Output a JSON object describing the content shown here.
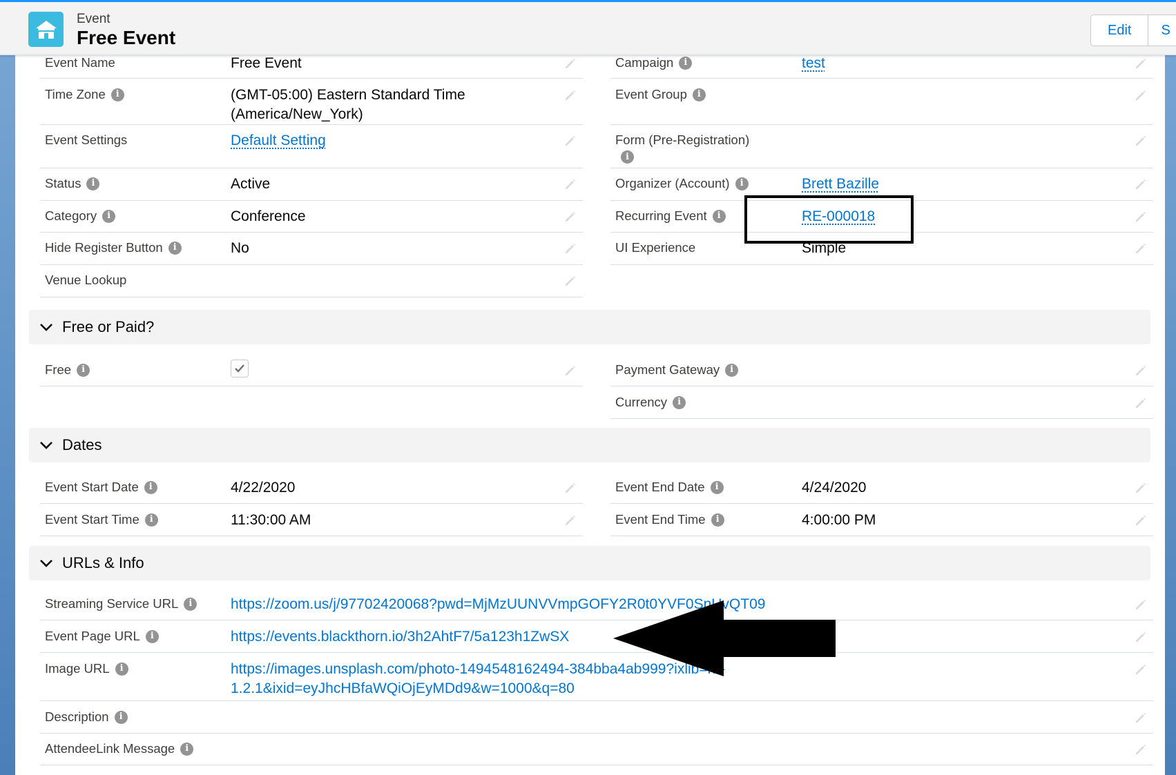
{
  "header": {
    "object_label": "Event",
    "record_title": "Free Event",
    "buttons": [
      "Edit",
      "S"
    ]
  },
  "colors": {
    "link": "#0176d3",
    "accent": "#1b96ff",
    "icon_bg": "#3cbbe0"
  },
  "info_glyph": "i",
  "fields_top": {
    "left": [
      {
        "label": "Event Name",
        "value": "Free Event",
        "info": false
      },
      {
        "label": "Time Zone",
        "value_line1": "(GMT-05:00) Eastern Standard Time",
        "value_line2": "(America/New_York)",
        "info": true
      },
      {
        "label": "Event Settings",
        "value": "Default Setting",
        "info": false
      },
      {
        "label": "Status",
        "value": "Active",
        "info": true
      },
      {
        "label": "Category",
        "value": "Conference",
        "info": true
      },
      {
        "label": "Hide Register Button",
        "value": "No",
        "info": true
      },
      {
        "label": "Venue Lookup",
        "value": "",
        "info": false
      }
    ],
    "right": [
      {
        "label": "Campaign",
        "value": "test",
        "info": true
      },
      {
        "label": "Event Group",
        "value": "",
        "info": true
      },
      {
        "label": "Form (Pre-Registration)",
        "value": "",
        "info": true
      },
      {
        "label": "Organizer (Account)",
        "value": "Brett Bazille",
        "info": true
      },
      {
        "label": "Recurring Event",
        "value": "RE-000018",
        "info": true
      },
      {
        "label": "UI Experience",
        "value": "Simple",
        "info": false
      }
    ]
  },
  "section_free": {
    "title": "Free or Paid?",
    "left": [
      {
        "label": "Free",
        "checked": true
      }
    ],
    "right": [
      {
        "label": "Payment Gateway",
        "value": ""
      },
      {
        "label": "Currency",
        "value": ""
      }
    ]
  },
  "section_dates": {
    "title": "Dates",
    "left": [
      {
        "label": "Event Start Date",
        "value": "4/22/2020"
      },
      {
        "label": "Event Start Time",
        "value": "11:30:00 AM"
      }
    ],
    "right": [
      {
        "label": "Event End Date",
        "value": "4/24/2020"
      },
      {
        "label": "Event End Time",
        "value": "4:00:00 PM"
      }
    ]
  },
  "section_urls": {
    "title": "URLs & Info",
    "rows": [
      {
        "label": "Streaming Service URL",
        "value": "https://zoom.us/j/97702420068?pwd=MjMzUUNVVmpGOFY2R0t0YVF0SnUvQT09"
      },
      {
        "label": "Event Page URL",
        "value": "https://events.blackthorn.io/3h2AhtF7/5a123h1ZwSX"
      },
      {
        "label": "Image URL",
        "value_line1": "https://images.unsplash.com/photo-1494548162494-384bba4ab999?ixlib=rb-",
        "value_line2": "1.2.1&ixid=eyJhcHBfaWQiOjEyMDd9&w=1000&q=80"
      },
      {
        "label": "Description",
        "value": ""
      },
      {
        "label": "AttendeeLink Message",
        "value": ""
      }
    ]
  }
}
